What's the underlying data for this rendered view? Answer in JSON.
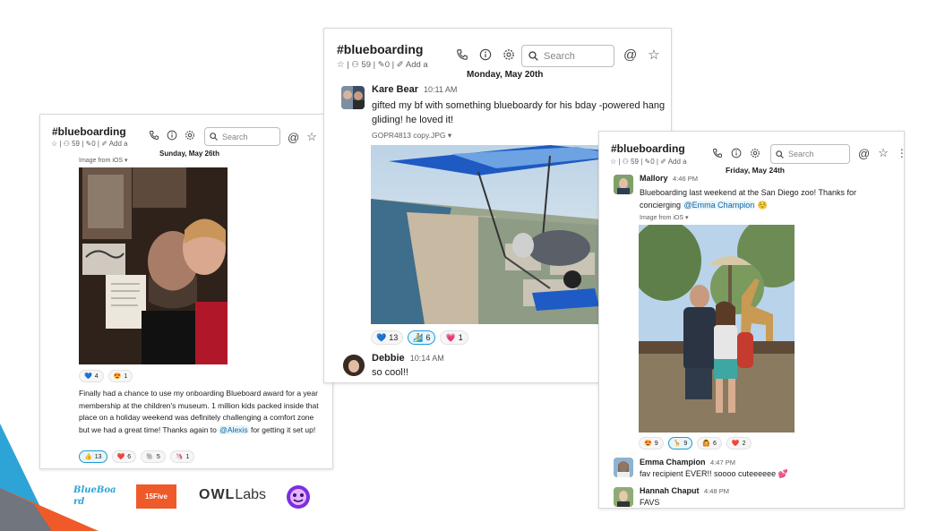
{
  "channel": "#blueboarding",
  "icons": {
    "star": "star-icon",
    "person": "person-icon",
    "pin": "pin-icon",
    "edit": "pencil-icon",
    "phone": "phone-icon",
    "info": "info-icon",
    "gear": "gear-icon",
    "search": "search-icon",
    "at": "at-icon",
    "more": "more-icon"
  },
  "win_left": {
    "members": "59",
    "pins": "0",
    "add": "Add a",
    "search_placeholder": "Search",
    "date": "Sunday, May 26th",
    "attachment": "Image from iOS ▾",
    "reactions_top": [
      {
        "emoji": "💙",
        "count": "4"
      },
      {
        "emoji": "😍",
        "count": "1"
      }
    ],
    "message": "Finally had a chance to use my onboarding Blueboard award for a year membership at the children's museum. 1 million kids packed inside that place on a holiday weekend was definitely challenging a comfort zone but we had a great time! Thanks again to",
    "mention": "@Alexis",
    "message_end": "for getting it set up!",
    "reactions": [
      {
        "emoji": "👍",
        "count": "13"
      },
      {
        "emoji": "❤️",
        "count": "6"
      },
      {
        "emoji": "🐘",
        "count": "5"
      },
      {
        "emoji": "🦄",
        "count": "1"
      }
    ]
  },
  "win_center": {
    "members": "59",
    "pins": "0",
    "add": "Add a",
    "search_placeholder": "Search",
    "date": "Monday, May 20th",
    "msg1": {
      "user": "Kare Bear",
      "time": "10:11 AM",
      "text": "gifted my bf with something blueboardy for his bday -powered hang gliding! he loved it!",
      "attachment": "GOPR4813 copy.JPG ▾"
    },
    "reactions": [
      {
        "emoji": "💙",
        "count": "13"
      },
      {
        "emoji": "🏄",
        "count": "6"
      },
      {
        "emoji": "💗",
        "count": "1"
      }
    ],
    "msg2": {
      "user": "Debbie",
      "time": "10:14 AM",
      "text": "so cool!!"
    }
  },
  "win_right": {
    "members": "59",
    "pins": "0",
    "add": "Add a",
    "search_placeholder": "Search",
    "date": "Friday, May 24th",
    "msg1": {
      "user": "Mallory",
      "time": "4:46 PM",
      "text": "Blueboarding last weekend at the San Diego zoo! Thanks for concierging",
      "mention": "@Emma Champion",
      "emoji": "☺️",
      "attachment": "Image from iOS ▾"
    },
    "reactions": [
      {
        "emoji": "😍",
        "count": "9"
      },
      {
        "emoji": "🦒",
        "count": "9"
      },
      {
        "emoji": "🙆",
        "count": "6"
      },
      {
        "emoji": "❤️",
        "count": "2"
      }
    ],
    "msg2": {
      "user": "Emma Champion",
      "time": "4:47 PM",
      "text": "fav recipient EVER!! soooo cuteeeeee 💕"
    },
    "msg3": {
      "user": "Hannah Chaput",
      "time": "4:48 PM",
      "text": "FAVS"
    }
  },
  "logos": {
    "blueboard": "BlueBoard",
    "fifteen_five": "15Five",
    "owl": "OWL",
    "owl_labs": "Labs"
  },
  "colors": {
    "accent": "#1264a3",
    "mention_bg": "#e8f5fa",
    "corner_blue": "#2ea3d6",
    "corner_orange": "#f05a28",
    "fifteen_five": "#ef5a2b",
    "owl_purple": "#7b2fe0"
  }
}
